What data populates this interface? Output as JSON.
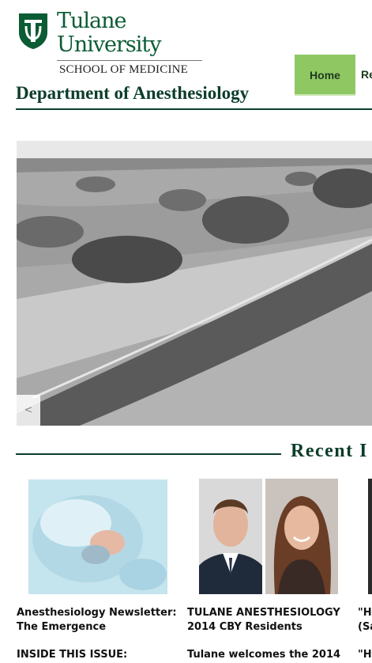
{
  "brand": {
    "university_line1": "Tulane",
    "university_line2": "University",
    "school": "SCHOOL OF MEDICINE",
    "department": "Department of Anesthesiology",
    "color_green": "#0b5b34"
  },
  "nav": {
    "home_label": "Home",
    "next_label": "Re"
  },
  "hero": {
    "prev_label": "<"
  },
  "recent": {
    "title": "Recent I",
    "items": [
      {
        "title_line1": "Anesthesiology Newsletter:",
        "title_line2": "The Emergence",
        "body": "INSIDE THIS ISSUE:"
      },
      {
        "title_line1": "TULANE ANESTHESIOLOGY",
        "title_line2": "2014 CBY Residents",
        "body": "Tulane welcomes the 2014"
      },
      {
        "title_line1": "\"H",
        "title_line2": "(Sa",
        "body": "\"H"
      }
    ]
  }
}
